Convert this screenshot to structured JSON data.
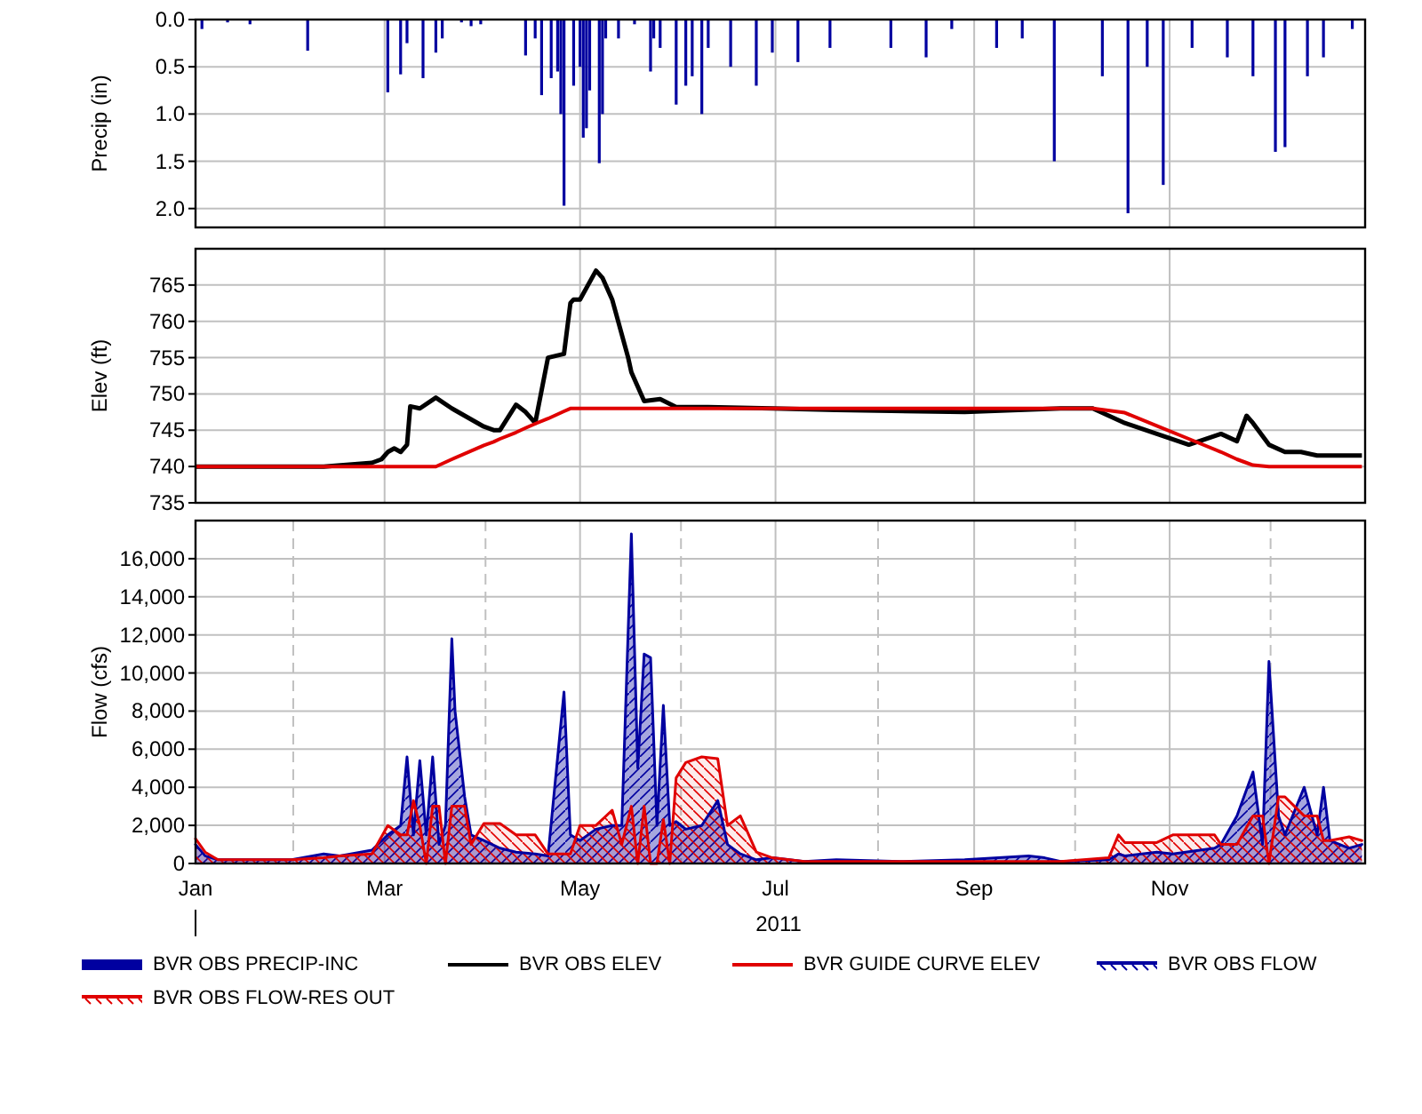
{
  "charts": [
    {
      "chart_data": {
        "type": "bar",
        "ylabel": "Precip (in)",
        "grid": true,
        "xlim": [
          "2011-01-01",
          "2012-01-01"
        ],
        "ylim": [
          2.2,
          0
        ],
        "yticks": [
          {
            "value": 0,
            "label": "0.0"
          },
          {
            "value": 0.5,
            "label": "0.5"
          },
          {
            "value": 1,
            "label": "1.0"
          },
          {
            "value": 1.5,
            "label": "1.5"
          },
          {
            "value": 2,
            "label": "2.0"
          }
        ],
        "x": [
          "2011-01-03",
          "2011-01-11",
          "2011-01-18",
          "2011-02-05",
          "2011-03-02",
          "2011-03-06",
          "2011-03-08",
          "2011-03-13",
          "2011-03-17",
          "2011-03-19",
          "2011-03-25",
          "2011-03-28",
          "2011-03-31",
          "2011-04-14",
          "2011-04-17",
          "2011-04-19",
          "2011-04-22",
          "2011-04-24",
          "2011-04-25",
          "2011-04-26",
          "2011-04-29",
          "2011-05-01",
          "2011-05-02",
          "2011-05-03",
          "2011-05-04",
          "2011-05-07",
          "2011-05-08",
          "2011-05-09",
          "2011-05-13",
          "2011-05-18",
          "2011-05-23",
          "2011-05-24",
          "2011-05-26",
          "2011-05-31",
          "2011-06-03",
          "2011-06-05",
          "2011-06-08",
          "2011-06-10",
          "2011-06-17",
          "2011-06-25",
          "2011-06-30",
          "2011-07-08",
          "2011-07-18",
          "2011-08-06",
          "2011-08-17",
          "2011-08-25",
          "2011-09-08",
          "2011-09-16",
          "2011-09-26",
          "2011-10-11",
          "2011-10-19",
          "2011-10-25",
          "2011-10-30",
          "2011-11-08",
          "2011-11-19",
          "2011-11-27",
          "2011-12-04",
          "2011-12-07",
          "2011-12-14",
          "2011-12-19",
          "2011-12-28"
        ],
        "series": [
          {
            "name": "BVR OBS PRECIP-INC",
            "color": "#0000a0",
            "values": [
              0.1,
              0.03,
              0.05,
              0.33,
              0.77,
              0.58,
              0.25,
              0.62,
              0.35,
              0.2,
              0.03,
              0.07,
              0.05,
              0.38,
              0.2,
              0.8,
              0.62,
              0.55,
              1.0,
              1.97,
              0.7,
              0.5,
              1.25,
              1.15,
              0.75,
              1.52,
              1.0,
              0.2,
              0.2,
              0.05,
              0.55,
              0.2,
              0.3,
              0.9,
              0.7,
              0.6,
              1.0,
              0.3,
              0.5,
              0.7,
              0.35,
              0.45,
              0.3,
              0.3,
              0.4,
              0.1,
              0.3,
              0.2,
              1.5,
              0.6,
              2.05,
              0.5,
              1.75,
              0.3,
              0.4,
              0.6,
              1.4,
              1.35,
              0.6,
              0.4,
              0.1
            ]
          }
        ]
      }
    },
    {
      "chart_data": {
        "type": "line",
        "ylabel": "Elev (ft)",
        "grid": true,
        "xlim": [
          "2011-01-01",
          "2012-01-01"
        ],
        "ylim": [
          735,
          770
        ],
        "yticks": [
          735,
          740,
          745,
          750,
          755,
          760,
          765
        ],
        "x": [
          "2011-01-01",
          "2011-01-21",
          "2011-02-10",
          "2011-02-25",
          "2011-02-28",
          "2011-03-02",
          "2011-03-04",
          "2011-03-06",
          "2011-03-08",
          "2011-03-09",
          "2011-03-12",
          "2011-03-17",
          "2011-03-22",
          "2011-04-01",
          "2011-04-04",
          "2011-04-06",
          "2011-04-11",
          "2011-04-14",
          "2011-04-17",
          "2011-04-21",
          "2011-04-26",
          "2011-04-28",
          "2011-04-29",
          "2011-05-01",
          "2011-05-06",
          "2011-05-08",
          "2011-05-11",
          "2011-05-16",
          "2011-05-17",
          "2011-05-21",
          "2011-05-26",
          "2011-05-31",
          "2011-06-10",
          "2011-06-30",
          "2011-07-20",
          "2011-08-29",
          "2011-09-28",
          "2011-10-08",
          "2011-10-18",
          "2011-10-28",
          "2011-11-07",
          "2011-11-17",
          "2011-11-22",
          "2011-11-25",
          "2011-11-27",
          "2011-12-02",
          "2011-12-07",
          "2011-12-12",
          "2011-12-17",
          "2011-12-31"
        ],
        "series": [
          {
            "name": "BVR OBS ELEV",
            "color": "#000000",
            "values": [
              740,
              740,
              740,
              740.5,
              741,
              742,
              742.5,
              742,
              743,
              748.3,
              748,
              749.5,
              748,
              745.5,
              745,
              745,
              748.5,
              747.5,
              746,
              755,
              755.5,
              762.5,
              763,
              763,
              767,
              766,
              763,
              755,
              753,
              749,
              749.3,
              748.2,
              748.2,
              748,
              747.8,
              747.5,
              748,
              748,
              746,
              744.5,
              743,
              744.5,
              743.5,
              747,
              746,
              743,
              742,
              742,
              741.5,
              741.5
            ]
          },
          {
            "name": "BVR GUIDE CURVE ELEV",
            "color": "#e00000",
            "values": [
              740,
              740,
              740,
              740,
              740,
              740,
              740,
              740,
              740,
              740,
              740,
              740,
              741,
              742.9,
              743.4,
              743.8,
              744.7,
              745.3,
              745.9,
              746.6,
              747.6,
              748,
              748,
              748,
              748,
              748,
              748,
              748,
              748,
              748,
              748,
              748,
              748,
              748,
              748,
              748,
              748,
              748,
              747.4,
              745.6,
              743.8,
              742,
              741,
              740.5,
              740.2,
              740,
              740,
              740,
              740,
              740
            ]
          }
        ]
      }
    },
    {
      "chart_data": {
        "type": "area",
        "ylabel": "Flow (cfs)",
        "grid": true,
        "xlabel": "2011",
        "xlim": [
          "2011-01-01",
          "2012-01-01"
        ],
        "ylim": [
          0,
          18000
        ],
        "xticks": [
          {
            "value": "2011-01-01",
            "label": "Jan"
          },
          {
            "value": "2011-03-01",
            "label": "Mar"
          },
          {
            "value": "2011-05-01",
            "label": "May"
          },
          {
            "value": "2011-07-01",
            "label": "Jul"
          },
          {
            "value": "2011-09-01",
            "label": "Sep"
          },
          {
            "value": "2011-11-01",
            "label": "Nov"
          }
        ],
        "yticks": [
          {
            "value": 0,
            "label": "0"
          },
          {
            "value": 2000,
            "label": "2,000"
          },
          {
            "value": 4000,
            "label": "4,000"
          },
          {
            "value": 6000,
            "label": "6,000"
          },
          {
            "value": 8000,
            "label": "8,000"
          },
          {
            "value": 10000,
            "label": "10,000"
          },
          {
            "value": 12000,
            "label": "12,000"
          },
          {
            "value": 14000,
            "label": "14,000"
          },
          {
            "value": 16000,
            "label": "16,000"
          }
        ],
        "x": [
          "2011-01-01",
          "2011-01-04",
          "2011-01-08",
          "2011-01-16",
          "2011-01-31",
          "2011-02-10",
          "2011-02-15",
          "2011-02-25",
          "2011-03-02",
          "2011-03-06",
          "2011-03-08",
          "2011-03-10",
          "2011-03-12",
          "2011-03-14",
          "2011-03-16",
          "2011-03-18",
          "2011-03-20",
          "2011-03-22",
          "2011-03-23",
          "2011-03-26",
          "2011-03-28",
          "2011-04-01",
          "2011-04-06",
          "2011-04-11",
          "2011-04-17",
          "2011-04-21",
          "2011-04-26",
          "2011-04-28",
          "2011-05-01",
          "2011-05-06",
          "2011-05-11",
          "2011-05-14",
          "2011-05-17",
          "2011-05-19",
          "2011-05-21",
          "2011-05-23",
          "2011-05-25",
          "2011-05-27",
          "2011-05-29",
          "2011-05-31",
          "2011-06-03",
          "2011-06-08",
          "2011-06-13",
          "2011-06-16",
          "2011-06-20",
          "2011-06-25",
          "2011-06-30",
          "2011-07-10",
          "2011-07-20",
          "2011-08-09",
          "2011-08-29",
          "2011-09-18",
          "2011-09-23",
          "2011-09-28",
          "2011-10-13",
          "2011-10-16",
          "2011-10-18",
          "2011-10-28",
          "2011-11-02",
          "2011-11-15",
          "2011-11-17",
          "2011-11-22",
          "2011-11-27",
          "2011-11-30",
          "2011-12-02",
          "2011-12-05",
          "2011-12-07",
          "2011-12-13",
          "2011-12-17",
          "2011-12-19",
          "2011-12-21",
          "2011-12-27",
          "2011-12-31"
        ],
        "series": [
          {
            "name": "BVR OBS FLOW",
            "color": "#0000a0",
            "values": [
              1000,
              400,
              200,
              200,
              200,
              500,
              400,
              700,
              1500,
              2000,
              5600,
              1500,
              5400,
              1500,
              5600,
              1000,
              2000,
              11800,
              8000,
              3500,
              1500,
              1200,
              800,
              600,
              500,
              400,
              9000,
              1500,
              1200,
              1800,
              2000,
              2000,
              17300,
              5000,
              11000,
              10800,
              2000,
              8300,
              2000,
              2200,
              1800,
              2000,
              3300,
              1000,
              500,
              200,
              300,
              100,
              200,
              100,
              200,
              400,
              300,
              100,
              200,
              500,
              400,
              600,
              500,
              800,
              1000,
              2500,
              4800,
              1000,
              10600,
              2500,
              1500,
              4000,
              1500,
              4000,
              1200,
              800,
              1000
            ]
          },
          {
            "name": "BVR OBS FLOW-RES OUT",
            "color": "#e00000",
            "values": [
              1300,
              600,
              200,
              200,
              200,
              300,
              400,
              500,
              2000,
              1500,
              1500,
              3300,
              2000,
              0,
              3000,
              3000,
              0,
              3000,
              3000,
              3000,
              1000,
              2100,
              2100,
              1500,
              1500,
              500,
              500,
              500,
              2000,
              2000,
              2800,
              1000,
              3000,
              0,
              3000,
              0,
              0,
              2300,
              0,
              4500,
              5300,
              5600,
              5500,
              2000,
              2500,
              600,
              300,
              100,
              100,
              100,
              100,
              100,
              100,
              100,
              300,
              1500,
              1100,
              1100,
              1500,
              1500,
              1000,
              1000,
              2500,
              2500,
              0,
              3500,
              3500,
              2500,
              2500,
              1200,
              1200,
              1400,
              1200
            ]
          }
        ]
      }
    }
  ]
}
